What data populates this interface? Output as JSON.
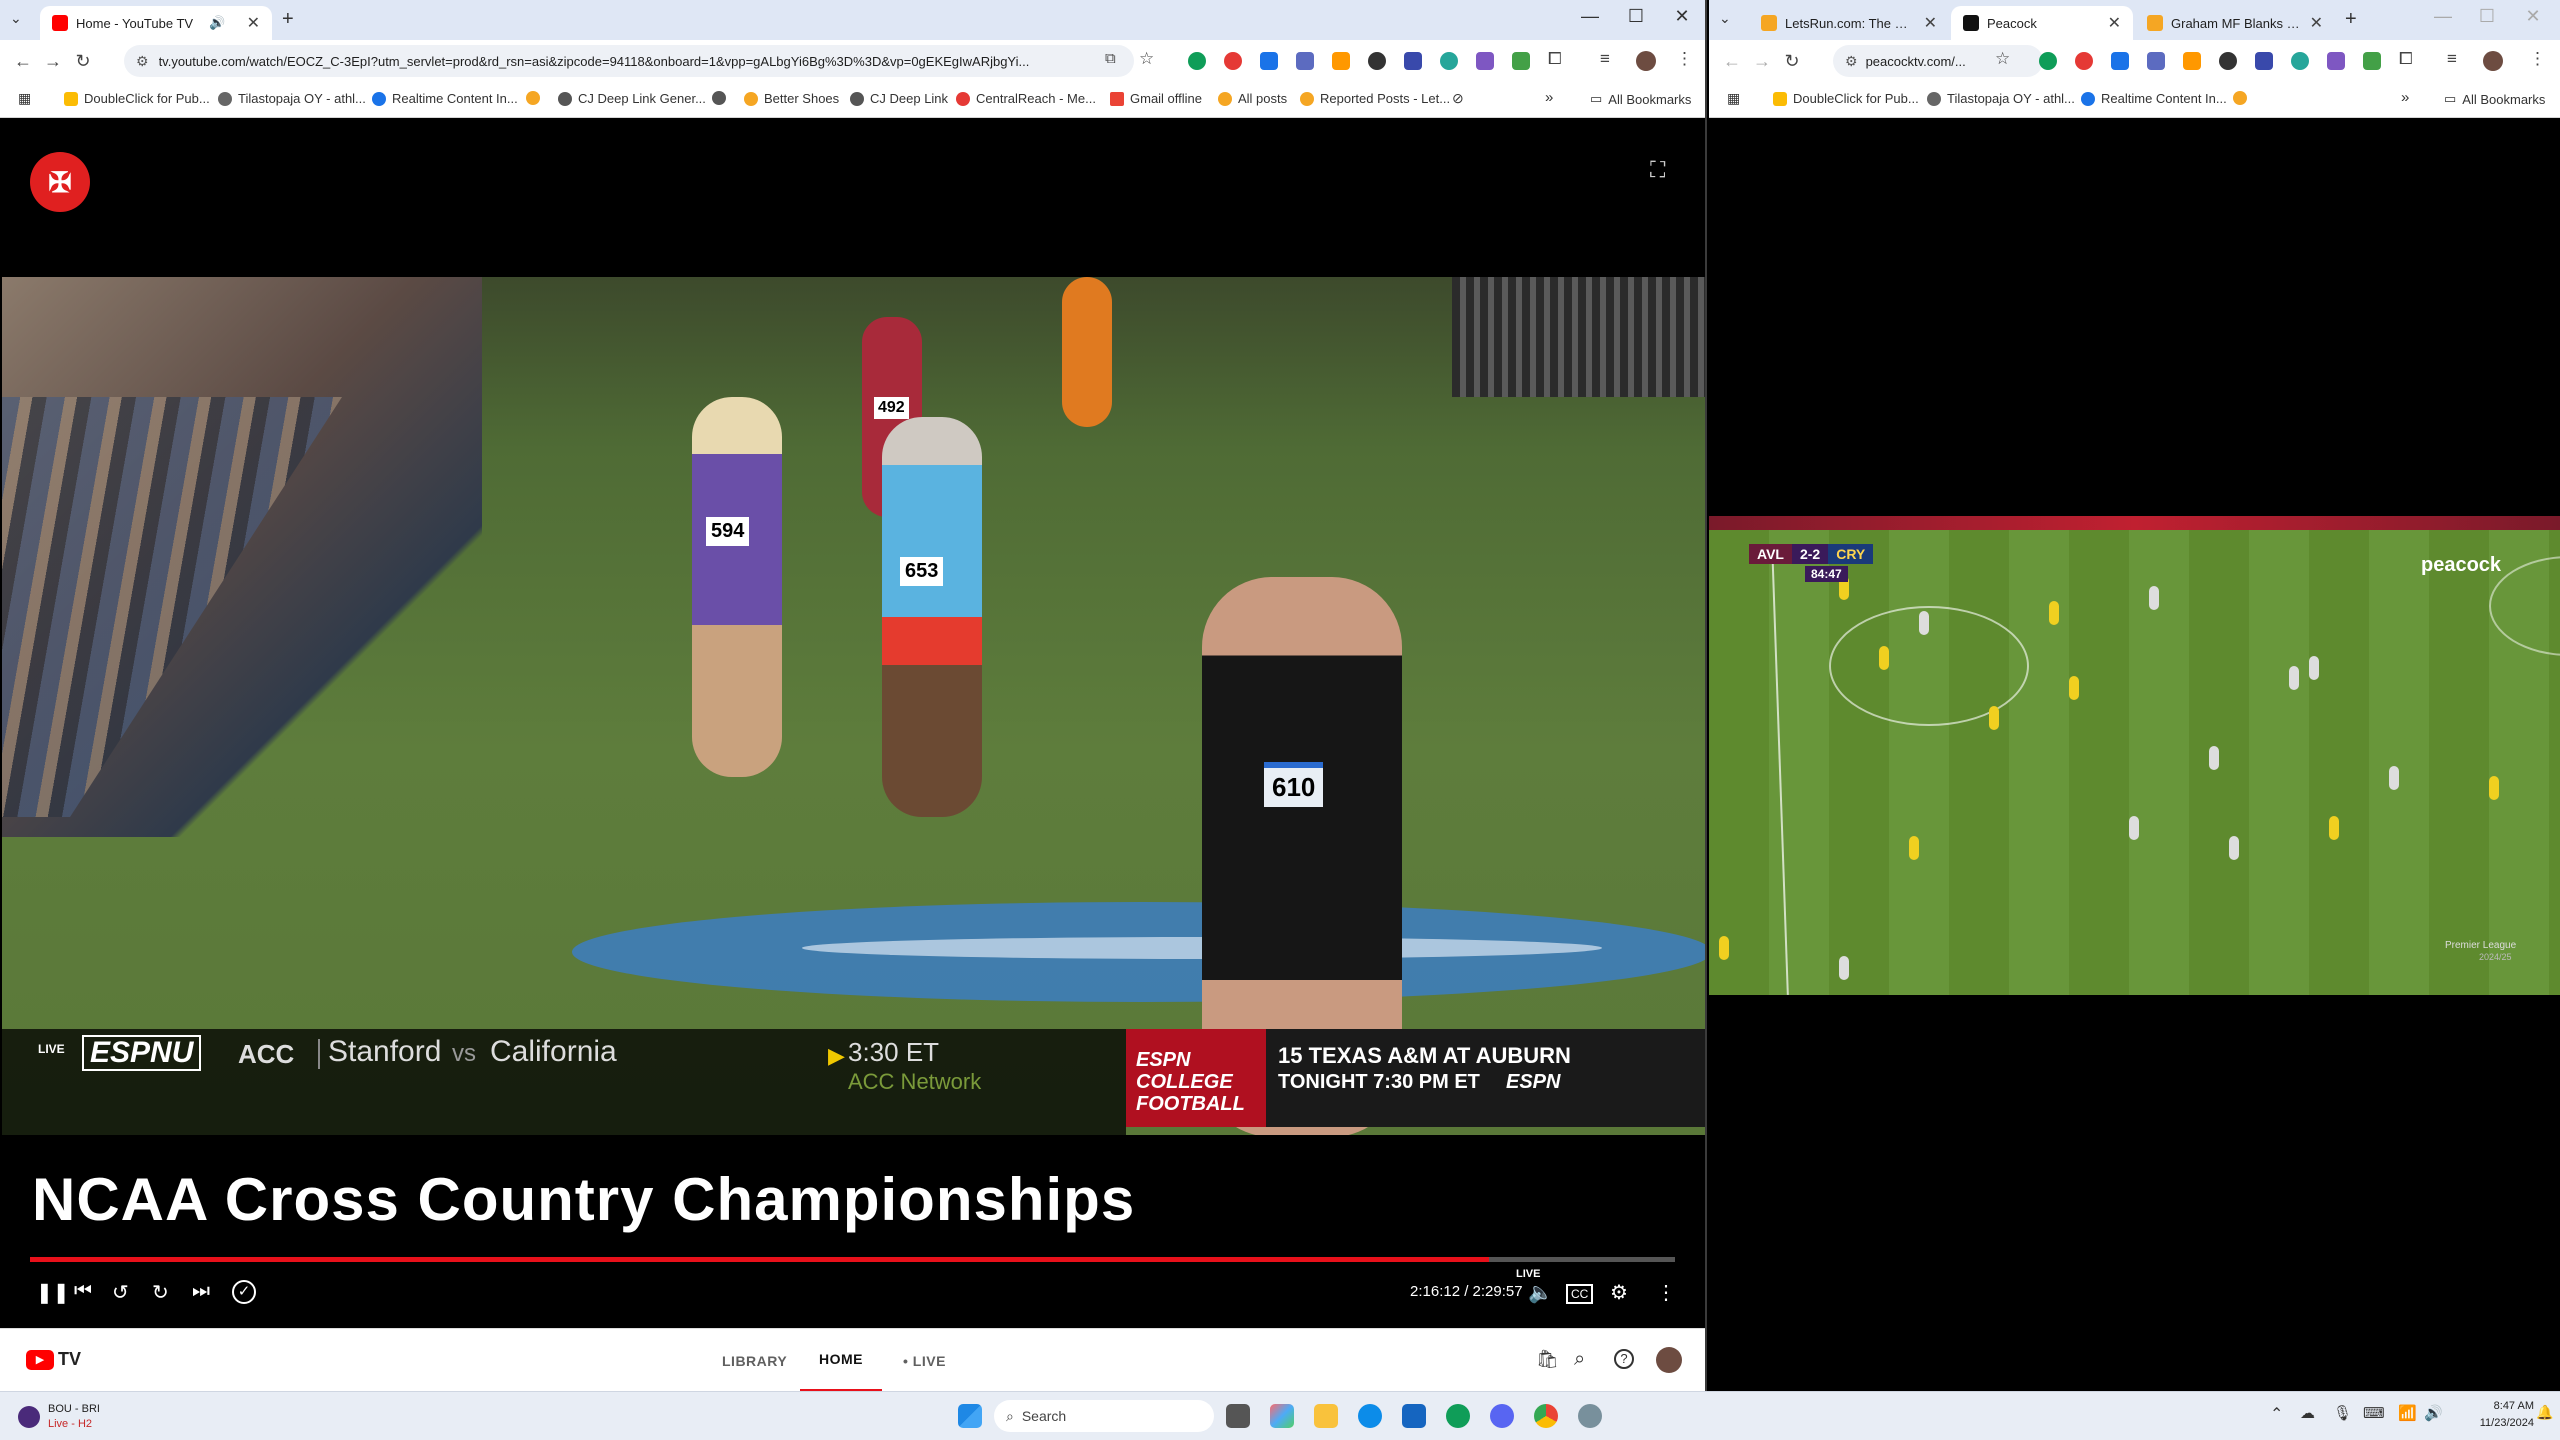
{
  "left_window": {
    "tabs": [
      {
        "title": "Home - YouTube TV",
        "active": true
      },
      {
        "title": "",
        "active": false
      }
    ],
    "url": "tv.youtube.com/watch/EOCZ_C-3EpI?utm_servlet=prod&rd_rsn=asi&zipcode=94118&onboard=1&vpp=gALbgYi6Bg%3D%3D&vp=0gEKEgIwARjbgYi...",
    "bookmarks": [
      "DoubleClick for Pub...",
      "Tilastopaja OY - athl...",
      "Realtime Content In...",
      "",
      "CJ Deep Link Gener...",
      "",
      "Better Shoes",
      "CJ Deep Link",
      "CentralReach - Me...",
      "Gmail offline",
      "All posts",
      "Reported Posts - Let..."
    ],
    "all_bookmarks": "All Bookmarks",
    "player": {
      "live_badge": "LIVE",
      "network": "ESPNU",
      "ticker": {
        "conf": "ACC",
        "team1": "Stanford",
        "vs": "vs",
        "team2": "California",
        "time": "3:30 ET",
        "channel": "ACC Network"
      },
      "promo": {
        "brand": "ESPN COLLEGE FOOTBALL",
        "line1": "15 TEXAS A&M AT AUBURN",
        "line2": "TONIGHT 7:30 PM ET",
        "net": "ESPN"
      },
      "title": "NCAA Cross Country Championships",
      "progress_fraction": 0.887,
      "live_label": "LIVE",
      "time": "2:16:12 / 2:29:57",
      "bibs": [
        "492",
        "594",
        "653",
        "610"
      ]
    },
    "ytnav": {
      "brand": "TV",
      "tabs": [
        "LIBRARY",
        "HOME",
        "• LIVE"
      ],
      "active_tab": "HOME"
    }
  },
  "right_window": {
    "tabs": [
      {
        "title": "LetsRun.com: The Hom...",
        "active": false
      },
      {
        "title": "Peacock",
        "active": true
      },
      {
        "title": "Graham MF Blanks ma...",
        "active": false
      }
    ],
    "url": "peacocktv.com/...",
    "bookmarks": [
      "DoubleClick for Pub...",
      "Tilastopaja OY - athl...",
      "Realtime Content In...",
      ""
    ],
    "all_bookmarks": "All Bookmarks",
    "match": {
      "home": "AVL",
      "score": "2-2",
      "away": "CRY",
      "clock": "84:47",
      "broadcaster": "peacock",
      "league": "Premier League",
      "season": "2024/25"
    }
  },
  "taskbar": {
    "widget_title": "BOU - BRI",
    "widget_sub": "Live - H2",
    "search_placeholder": "Search",
    "time": "8:47 AM",
    "date": "11/23/2024"
  }
}
